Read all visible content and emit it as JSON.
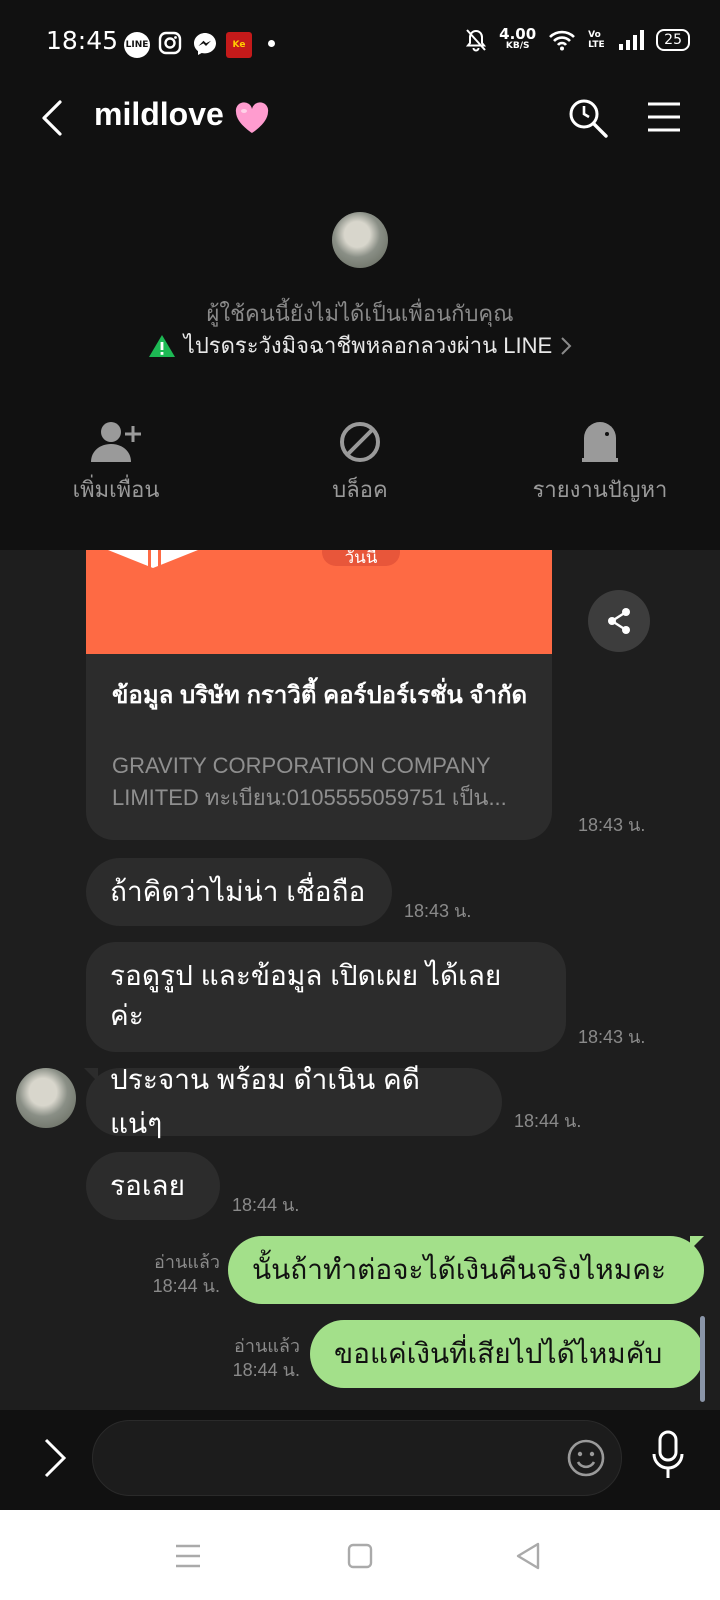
{
  "status_bar": {
    "time": "18:45",
    "net_speed_value": "4.00",
    "net_speed_unit": "KB/S",
    "volte": "Vo LTE",
    "battery": "25",
    "notification_icons": [
      "line-app-icon",
      "instagram-icon",
      "messenger-icon",
      "kerry-app-icon"
    ]
  },
  "header": {
    "title": "mildlove",
    "not_friend_text": "ผู้ใช้คนนี้ยังไม่ได้เป็นเพื่อนกับคุณ",
    "warning_text": "ไปรดระวังมิจฉาชีพหลอกลวงผ่าน LINE",
    "actions": [
      {
        "label": "เพิ่มเพื่อน",
        "icon": "add-friend-icon"
      },
      {
        "label": "บล็อค",
        "icon": "block-icon"
      },
      {
        "label": "รายงานปัญหา",
        "icon": "report-icon"
      }
    ]
  },
  "chat": {
    "link_card": {
      "badge": "วันนี้",
      "title": "ข้อมูล บริษัท กราวิตี้ คอร์ปอร์เรชั่น จำกัด",
      "desc_line1": "GRAVITY CORPORATION COMPANY",
      "desc_line2": "LIMITED ทะเบียน:0105555059751 เป็น...",
      "time": "18:43 น."
    },
    "messages": [
      {
        "text": "ถ้าคิดว่าไม่น่า เชื่อถือ",
        "time": "18:43 น.",
        "from": "other"
      },
      {
        "text_line1": "รอดูรูป และข้อมูล เปิดเผย ได้เลย",
        "text_line2": "ค่ะ",
        "time": "18:43 น.",
        "from": "other"
      },
      {
        "text": "ประจาน พร้อม ดำเนิน คดี แน่ๆ",
        "time": "18:44 น.",
        "from": "other"
      },
      {
        "text": "รอเลย",
        "time": "18:44 น.",
        "from": "other"
      },
      {
        "text": "นั้นถ้าทำต่อจะได้เงินคืนจริงไหมคะ",
        "read": "อ่านแล้ว",
        "time": "18:44 น.",
        "from": "me"
      },
      {
        "text": "ขอแค่เงินที่เสียไปได้ไหมคับ",
        "read": "อ่านแล้ว",
        "time": "18:44 น.",
        "from": "me"
      }
    ]
  },
  "input": {
    "placeholder": ""
  },
  "colors": {
    "accent_green": "#a3e08a",
    "card_orange": "#fe6a44",
    "warning_green": "#1db954"
  }
}
